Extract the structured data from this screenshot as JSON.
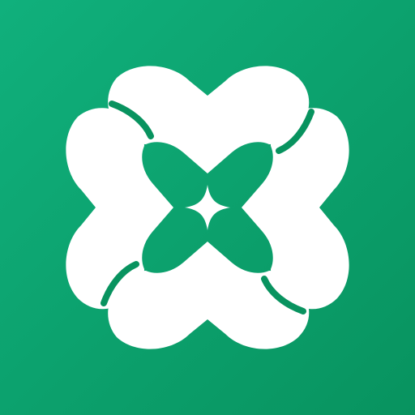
{
  "icon": {
    "name": "four-heart-clover-logo",
    "background_gradient": [
      "#10b07c",
      "#08935f"
    ],
    "mark_color": "#ffffff",
    "center_symbol": "four-point-sparkle"
  }
}
